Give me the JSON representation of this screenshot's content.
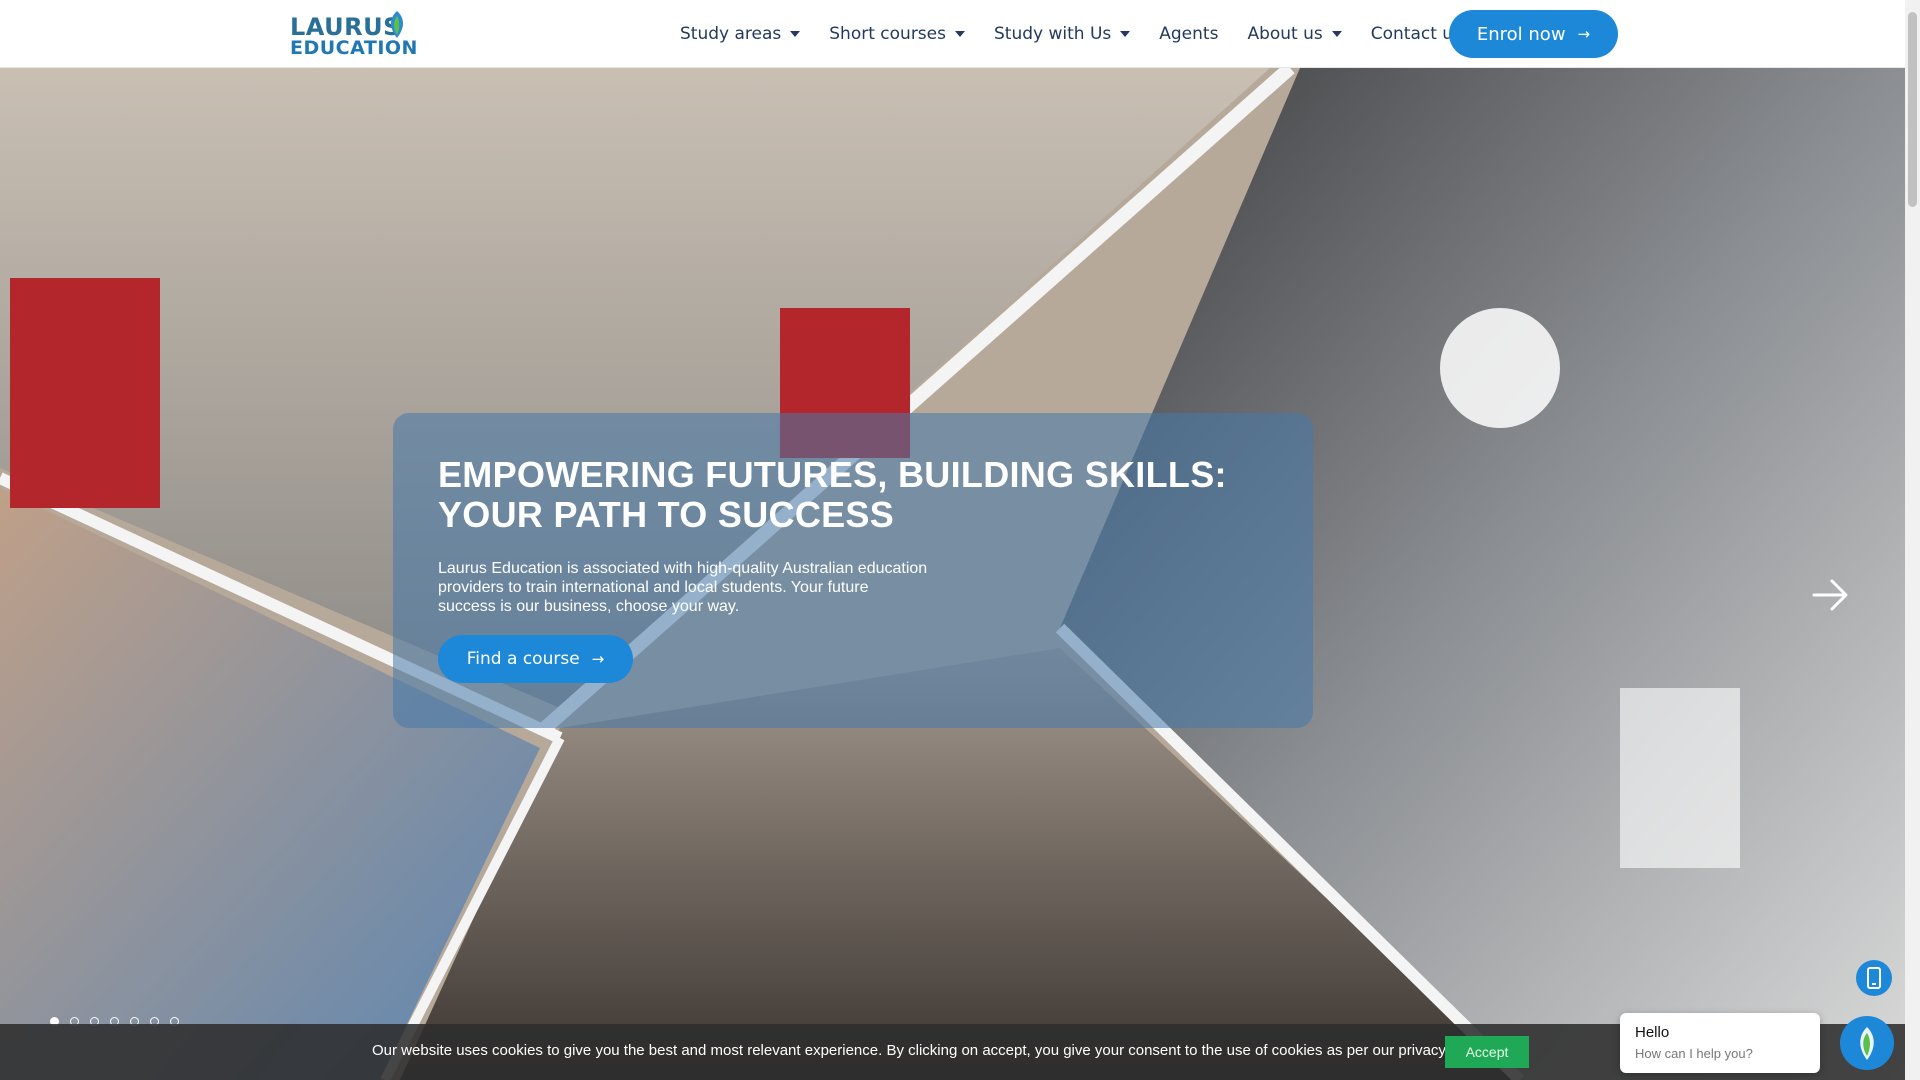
{
  "brand": {
    "logo_line1": "LAURUS",
    "logo_line2": "EDUCATION",
    "primary_color": "#1e88d8",
    "navy_color": "#23395d"
  },
  "nav": {
    "items": [
      {
        "label": "Study areas",
        "has_dropdown": true
      },
      {
        "label": "Short courses",
        "has_dropdown": true
      },
      {
        "label": "Study with Us",
        "has_dropdown": true
      },
      {
        "label": "Agents",
        "has_dropdown": false
      },
      {
        "label": "About us",
        "has_dropdown": true
      },
      {
        "label": "Contact us",
        "has_dropdown": false
      }
    ],
    "enrol_label": "Enrol now",
    "enrol_icon": "arrow-right-icon"
  },
  "hero": {
    "title": "EMPOWERING FUTURES, BUILDING SKILLS: YOUR PATH TO SUCCESS",
    "description": "Laurus Education is associated with high-quality Australian education providers to train international and local students. Your future success is our business, choose your way.",
    "cta_label": "Find a course",
    "cta_icon": "arrow-right-icon",
    "next_icon": "chevron-right-icon",
    "slide_count": 7,
    "active_slide": 1
  },
  "cookie": {
    "text": "Our website uses cookies to give you the best and most relevant experience. By clicking on accept, you give your consent to the use of cookies as per our privacy policy.",
    "accept_label": "Accept",
    "accept_color": "#1fa855"
  },
  "chat": {
    "greeting": "Hello",
    "prompt": "How can I help you?",
    "launcher_icon": "leaf-logo-icon",
    "phone_icon": "phone-icon"
  }
}
